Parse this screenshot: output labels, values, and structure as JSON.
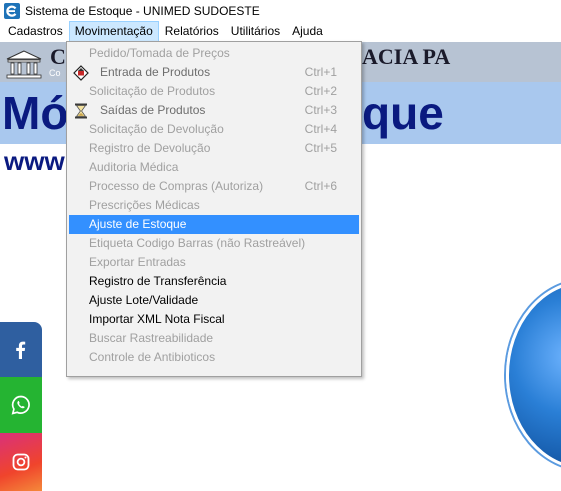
{
  "window": {
    "title": "Sistema de Estoque - UNIMED SUDOESTE",
    "app_icon": "e-logo-icon"
  },
  "menubar": {
    "items": [
      {
        "label": "Cadastros"
      },
      {
        "label": "Movimentação"
      },
      {
        "label": "Relatórios"
      },
      {
        "label": "Utilitários"
      },
      {
        "label": "Ajuda"
      }
    ]
  },
  "background": {
    "company_initial": "C",
    "company_right": "ACIA PA",
    "company_sub": "Co",
    "module_left": "Mó",
    "module_right": "que",
    "url_prefix": "www"
  },
  "dropdown": {
    "items": [
      {
        "label": "Pedido/Tomada de Preços",
        "shortcut": "",
        "state": "disabled"
      },
      {
        "label": "Entrada de Produtos",
        "shortcut": "Ctrl+1",
        "state": "dim",
        "icon": "box-arrow-icon"
      },
      {
        "label": "Solicitação de Produtos",
        "shortcut": "Ctrl+2",
        "state": "disabled"
      },
      {
        "label": "Saídas de Produtos",
        "shortcut": "Ctrl+3",
        "state": "dim",
        "icon": "hourglass-icon"
      },
      {
        "label": "Solicitação de Devolução",
        "shortcut": "Ctrl+4",
        "state": "disabled"
      },
      {
        "label": "Registro de Devolução",
        "shortcut": "Ctrl+5",
        "state": "disabled"
      },
      {
        "label": "Auditoria Médica",
        "shortcut": "",
        "state": "disabled"
      },
      {
        "label": "Processo de Compras (Autoriza)",
        "shortcut": "Ctrl+6",
        "state": "disabled"
      },
      {
        "label": "Prescrições Médicas",
        "shortcut": "",
        "state": "disabled"
      },
      {
        "label": "Ajuste de Estoque",
        "shortcut": "",
        "state": "selected"
      },
      {
        "label": "Etiqueta Codigo Barras (não Rastreável)",
        "shortcut": "",
        "state": "disabled"
      },
      {
        "label": "Exportar Entradas",
        "shortcut": "",
        "state": "disabled"
      },
      {
        "label": "Registro de Transferência",
        "shortcut": "",
        "state": "normal"
      },
      {
        "label": "Ajuste Lote/Validade",
        "shortcut": "",
        "state": "normal"
      },
      {
        "label": "Importar XML Nota Fiscal",
        "shortcut": "",
        "state": "normal"
      },
      {
        "label": "Buscar Rastreabilidade",
        "shortcut": "",
        "state": "disabled"
      },
      {
        "label": "Controle de Antibioticos",
        "shortcut": "",
        "state": "disabled"
      }
    ]
  },
  "social": [
    "facebook-icon",
    "whatsapp-icon",
    "instagram-icon"
  ],
  "colors": {
    "menu_highlight": "#3390ff",
    "menubar_active": "#cce8ff",
    "banner_blue": "#a9c8ee",
    "title_navy": "#0a1a80",
    "facebook": "#2f5fa0",
    "whatsapp": "#25b432"
  }
}
